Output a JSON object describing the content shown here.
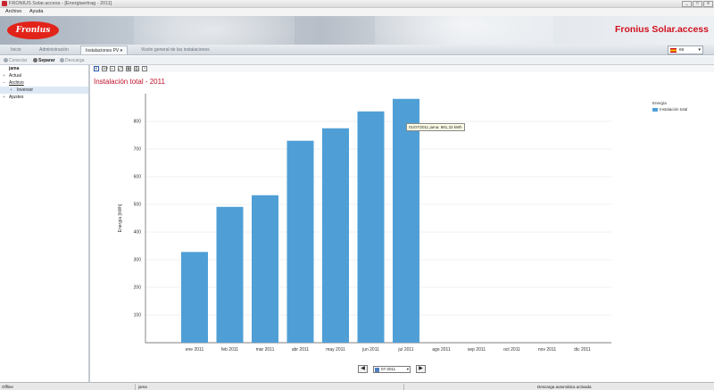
{
  "window": {
    "title": "FRONIUS Solar.access - [Energiaertrag - 2011]",
    "minimize": "_",
    "maximize": "□",
    "close": "x"
  },
  "menu": [
    "Archivo",
    "Ayuda"
  ],
  "banner": {
    "logo": "Fronius",
    "brand": "Fronius Solar.access"
  },
  "nav": {
    "tabs": [
      "Inicio",
      "Administración",
      "Instalaciones PV",
      "Visión general de las instalaciones"
    ],
    "active_index": 2,
    "language": "es"
  },
  "toolbar": {
    "connect": "Conectar",
    "disconnect": "Separar",
    "download": "Descarga"
  },
  "tree": [
    {
      "label": "jama",
      "level": 0,
      "expander": "",
      "bold": true
    },
    {
      "label": "Actual",
      "level": 0,
      "expander": "+"
    },
    {
      "label": "Archivo",
      "level": 0,
      "expander": "−"
    },
    {
      "label": "Inversor",
      "level": 1,
      "expander": "+",
      "selected": true
    },
    {
      "label": "Ajustes",
      "level": 0,
      "expander": "+"
    }
  ],
  "chart_toolbar": {
    "buttons": [
      "E",
      "10³",
      "◐",
      "⤢",
      "▦",
      "⎙",
      "?"
    ]
  },
  "chart_data": {
    "type": "bar",
    "title": "Instalación total - 2011",
    "ylabel": "Energía [kWh]",
    "xlabel": "",
    "categories": [
      "ene 2011",
      "feb 2011",
      "mar 2011",
      "abr 2011",
      "may 2011",
      "jun 2011",
      "jul 2011",
      "ago 2011",
      "sep 2011",
      "oct 2011",
      "nov 2011",
      "dic 2011"
    ],
    "series": [
      {
        "name": "Instalación total",
        "color": "#4f9fd6",
        "values": [
          328,
          491,
          533,
          730,
          775,
          836,
          881.33,
          null,
          null,
          null,
          null,
          null
        ]
      }
    ],
    "ylim": [
      0,
      900
    ],
    "yticks": [
      100,
      200,
      300,
      400,
      500,
      600,
      700,
      800
    ],
    "grid": true,
    "legend": {
      "title": "Energía",
      "position": "top-right"
    }
  },
  "tooltip": "01/07/2011 jama: 881,33 kWh",
  "pager": {
    "prev": "◀",
    "next": "▶",
    "value": "07-2011"
  },
  "status": {
    "connection": "Offline",
    "system": "jama",
    "download": "Descarga automática activada"
  }
}
